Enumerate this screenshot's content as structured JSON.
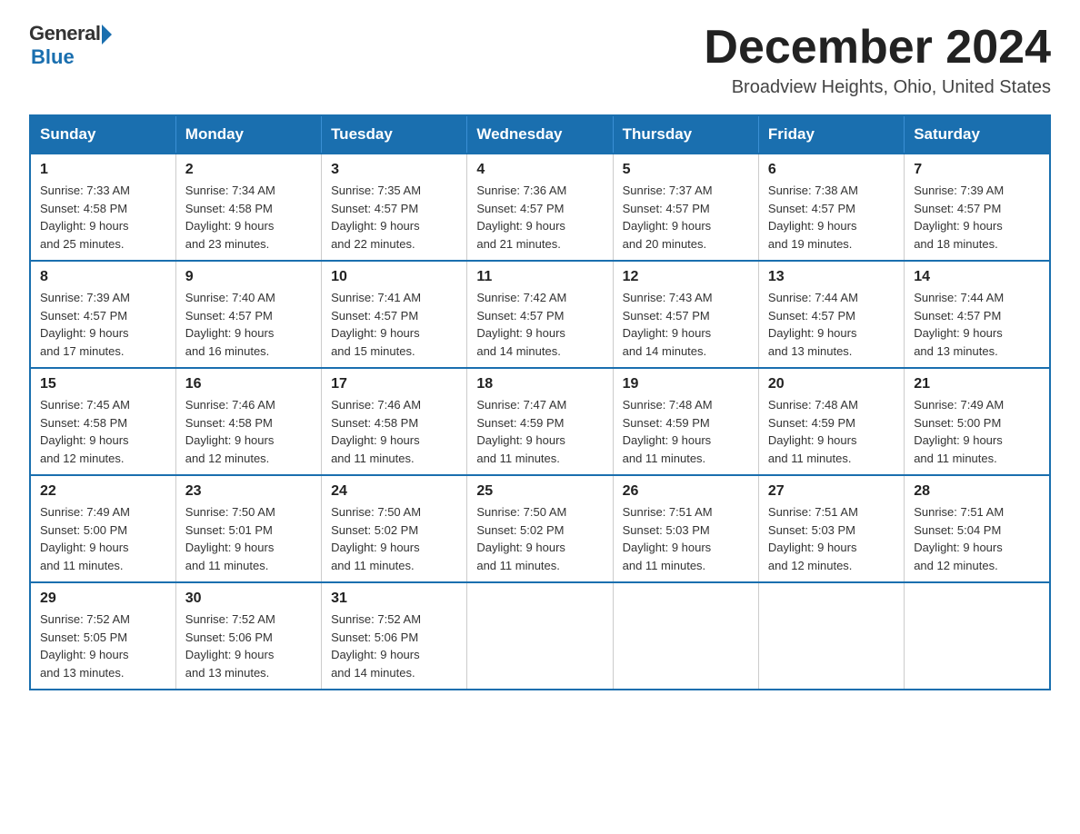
{
  "logo": {
    "general": "General",
    "blue": "Blue",
    "arrow": "▶"
  },
  "header": {
    "month_title": "December 2024",
    "location": "Broadview Heights, Ohio, United States"
  },
  "days_of_week": [
    "Sunday",
    "Monday",
    "Tuesday",
    "Wednesday",
    "Thursday",
    "Friday",
    "Saturday"
  ],
  "weeks": [
    [
      {
        "day": "1",
        "sunrise": "7:33 AM",
        "sunset": "4:58 PM",
        "daylight": "9 hours and 25 minutes."
      },
      {
        "day": "2",
        "sunrise": "7:34 AM",
        "sunset": "4:58 PM",
        "daylight": "9 hours and 23 minutes."
      },
      {
        "day": "3",
        "sunrise": "7:35 AM",
        "sunset": "4:57 PM",
        "daylight": "9 hours and 22 minutes."
      },
      {
        "day": "4",
        "sunrise": "7:36 AM",
        "sunset": "4:57 PM",
        "daylight": "9 hours and 21 minutes."
      },
      {
        "day": "5",
        "sunrise": "7:37 AM",
        "sunset": "4:57 PM",
        "daylight": "9 hours and 20 minutes."
      },
      {
        "day": "6",
        "sunrise": "7:38 AM",
        "sunset": "4:57 PM",
        "daylight": "9 hours and 19 minutes."
      },
      {
        "day": "7",
        "sunrise": "7:39 AM",
        "sunset": "4:57 PM",
        "daylight": "9 hours and 18 minutes."
      }
    ],
    [
      {
        "day": "8",
        "sunrise": "7:39 AM",
        "sunset": "4:57 PM",
        "daylight": "9 hours and 17 minutes."
      },
      {
        "day": "9",
        "sunrise": "7:40 AM",
        "sunset": "4:57 PM",
        "daylight": "9 hours and 16 minutes."
      },
      {
        "day": "10",
        "sunrise": "7:41 AM",
        "sunset": "4:57 PM",
        "daylight": "9 hours and 15 minutes."
      },
      {
        "day": "11",
        "sunrise": "7:42 AM",
        "sunset": "4:57 PM",
        "daylight": "9 hours and 14 minutes."
      },
      {
        "day": "12",
        "sunrise": "7:43 AM",
        "sunset": "4:57 PM",
        "daylight": "9 hours and 14 minutes."
      },
      {
        "day": "13",
        "sunrise": "7:44 AM",
        "sunset": "4:57 PM",
        "daylight": "9 hours and 13 minutes."
      },
      {
        "day": "14",
        "sunrise": "7:44 AM",
        "sunset": "4:57 PM",
        "daylight": "9 hours and 13 minutes."
      }
    ],
    [
      {
        "day": "15",
        "sunrise": "7:45 AM",
        "sunset": "4:58 PM",
        "daylight": "9 hours and 12 minutes."
      },
      {
        "day": "16",
        "sunrise": "7:46 AM",
        "sunset": "4:58 PM",
        "daylight": "9 hours and 12 minutes."
      },
      {
        "day": "17",
        "sunrise": "7:46 AM",
        "sunset": "4:58 PM",
        "daylight": "9 hours and 11 minutes."
      },
      {
        "day": "18",
        "sunrise": "7:47 AM",
        "sunset": "4:59 PM",
        "daylight": "9 hours and 11 minutes."
      },
      {
        "day": "19",
        "sunrise": "7:48 AM",
        "sunset": "4:59 PM",
        "daylight": "9 hours and 11 minutes."
      },
      {
        "day": "20",
        "sunrise": "7:48 AM",
        "sunset": "4:59 PM",
        "daylight": "9 hours and 11 minutes."
      },
      {
        "day": "21",
        "sunrise": "7:49 AM",
        "sunset": "5:00 PM",
        "daylight": "9 hours and 11 minutes."
      }
    ],
    [
      {
        "day": "22",
        "sunrise": "7:49 AM",
        "sunset": "5:00 PM",
        "daylight": "9 hours and 11 minutes."
      },
      {
        "day": "23",
        "sunrise": "7:50 AM",
        "sunset": "5:01 PM",
        "daylight": "9 hours and 11 minutes."
      },
      {
        "day": "24",
        "sunrise": "7:50 AM",
        "sunset": "5:02 PM",
        "daylight": "9 hours and 11 minutes."
      },
      {
        "day": "25",
        "sunrise": "7:50 AM",
        "sunset": "5:02 PM",
        "daylight": "9 hours and 11 minutes."
      },
      {
        "day": "26",
        "sunrise": "7:51 AM",
        "sunset": "5:03 PM",
        "daylight": "9 hours and 11 minutes."
      },
      {
        "day": "27",
        "sunrise": "7:51 AM",
        "sunset": "5:03 PM",
        "daylight": "9 hours and 12 minutes."
      },
      {
        "day": "28",
        "sunrise": "7:51 AM",
        "sunset": "5:04 PM",
        "daylight": "9 hours and 12 minutes."
      }
    ],
    [
      {
        "day": "29",
        "sunrise": "7:52 AM",
        "sunset": "5:05 PM",
        "daylight": "9 hours and 13 minutes."
      },
      {
        "day": "30",
        "sunrise": "7:52 AM",
        "sunset": "5:06 PM",
        "daylight": "9 hours and 13 minutes."
      },
      {
        "day": "31",
        "sunrise": "7:52 AM",
        "sunset": "5:06 PM",
        "daylight": "9 hours and 14 minutes."
      },
      null,
      null,
      null,
      null
    ]
  ],
  "labels": {
    "sunrise": "Sunrise:",
    "sunset": "Sunset:",
    "daylight": "Daylight:"
  },
  "colors": {
    "header_bg": "#1a6faf",
    "header_text": "#ffffff",
    "border": "#1a6faf"
  }
}
